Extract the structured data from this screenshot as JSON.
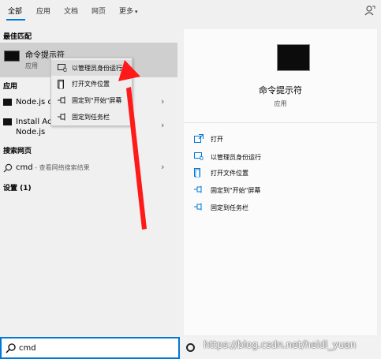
{
  "tabs": [
    {
      "label": "全部",
      "active": true
    },
    {
      "label": "应用"
    },
    {
      "label": "文档"
    },
    {
      "label": "网页"
    },
    {
      "label": "更多"
    }
  ],
  "tabs_more_chevron": "▾",
  "feedback_icon": "feedback-person-icon",
  "sections": {
    "best_match": "最佳匹配",
    "apps": "应用",
    "web_search": "搜索网页",
    "settings": "设置 (1)"
  },
  "best_match": {
    "title": "命令提示符",
    "subtitle": "应用"
  },
  "apps": [
    {
      "label": "Node.js c"
    },
    {
      "label_line1": "Install Ac",
      "label_line2": "Node.js"
    }
  ],
  "web_result": {
    "query": "cmd",
    "suffix": " - 查看网络搜索结果"
  },
  "context_menu": [
    {
      "label": "以管理员身份运行",
      "icon": "run-as-admin-icon",
      "hover": true
    },
    {
      "label": "打开文件位置",
      "icon": "file-location-icon"
    },
    {
      "label": "固定到\"开始\"屏幕",
      "icon": "pin-icon"
    },
    {
      "label": "固定到任务栏",
      "icon": "pin-icon"
    }
  ],
  "preview": {
    "title": "命令提示符",
    "subtitle": "应用",
    "actions": [
      {
        "label": "打开",
        "icon": "open-icon"
      },
      {
        "label": "以管理员身份运行",
        "icon": "run-as-admin-icon"
      },
      {
        "label": "打开文件位置",
        "icon": "file-location-icon"
      },
      {
        "label": "固定到\"开始\"屏幕",
        "icon": "pin-icon"
      },
      {
        "label": "固定到任务栏",
        "icon": "pin-icon"
      }
    ]
  },
  "search": {
    "value": "cmd"
  },
  "watermark": "https://blog.csdn.net/heidi_yuan",
  "chevron": "›",
  "colors": {
    "accent": "#0078d7",
    "arrow": "#ff1a1a",
    "best_match_bg": "#cfcfcf",
    "context_hover": "#dcdcdc"
  }
}
